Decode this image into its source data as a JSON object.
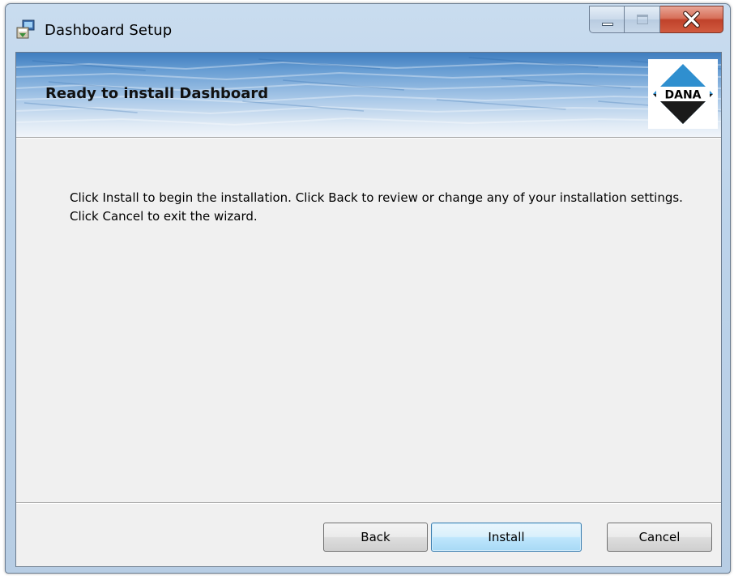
{
  "window": {
    "title": "Dashboard Setup",
    "icon": "installer-package-icon"
  },
  "caption_buttons": {
    "minimize": "minimize-icon",
    "maximize": "maximize-icon",
    "close": "close-icon"
  },
  "banner": {
    "title": "Ready to install Dashboard",
    "logo_text": "DANA"
  },
  "body": {
    "message": "Click Install to begin the installation. Click Back to review or change any of your installation settings. Click Cancel to exit the wizard."
  },
  "buttons": {
    "back": "Back",
    "install": "Install",
    "cancel": "Cancel"
  },
  "colors": {
    "close_button": "#c7452b",
    "default_button_border": "#3c7fb1",
    "logo_blue": "#2f8fcf"
  }
}
